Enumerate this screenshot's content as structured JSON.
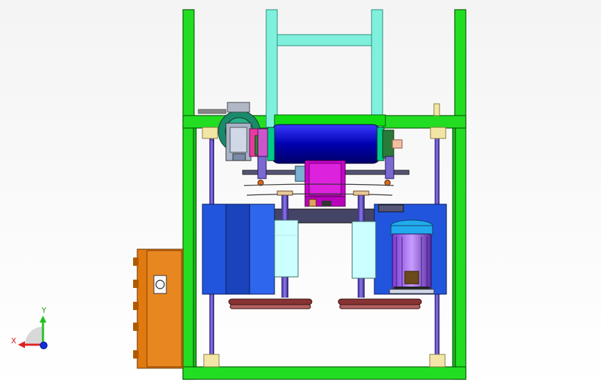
{
  "viewport": {
    "background_top": "#f4f4f4",
    "background_bottom": "#ffffff"
  },
  "colors": {
    "frame_green": "#22dd22",
    "frame_edge": "#0a5a0a",
    "gantry_teal": "#7ff0dc",
    "roller_blue": "#0000cc",
    "gearbox_magenta": "#cc00cc",
    "panel_blue": "#2255dd",
    "light_cyan": "#ccffff",
    "control_box_orange": "#e07a10",
    "post_tan": "#f2e6a6",
    "shaft_purple": "#5533aa",
    "beam_grey": "#444466",
    "pulley_red": "#883333"
  },
  "model": {
    "parts": [
      "outer-frame",
      "top-gantry",
      "drive-roller",
      "worm-gearbox",
      "center-gear-motor",
      "left-screen-panel",
      "right-motor-panel",
      "electric-motor",
      "control-box",
      "lead-screws",
      "belt-pulleys"
    ]
  },
  "triad": {
    "x_label": "X",
    "y_label": "Y",
    "x_color": "#e02020",
    "y_color": "#20c020",
    "z_color": "#1030e0"
  }
}
